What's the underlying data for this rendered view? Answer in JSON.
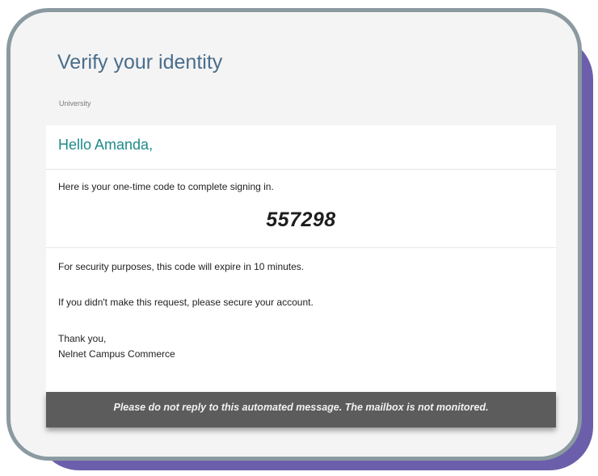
{
  "header": {
    "title": "Verify your identity",
    "subtitle": "University"
  },
  "email": {
    "greeting": "Hello Amanda,",
    "intro": "Here is your one-time code to complete signing in.",
    "code": "557298",
    "expiry_notice": "For security purposes, this code will expire in 10 minutes.",
    "request_notice": "If you didn't make this request, please secure your account.",
    "signoff": "Thank you,",
    "sender": "Nelnet Campus Commerce"
  },
  "footer": {
    "notice": "Please do not reply to this automated message. The mailbox is not monitored."
  },
  "colors": {
    "title": "#4a6d8c",
    "greeting": "#1f8a8a",
    "frame_border": "#8b9aa0",
    "shadow_card": "#6b5fab",
    "footer_bar": "#5c5c5c"
  }
}
